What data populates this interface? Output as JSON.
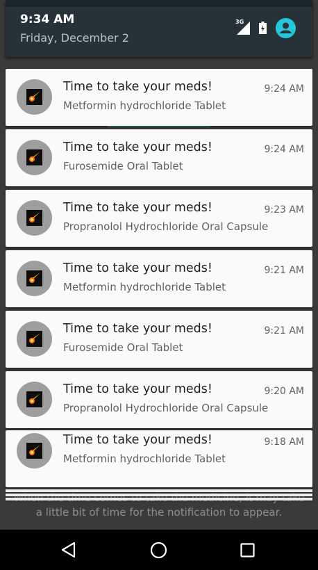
{
  "status": {
    "time": "9:34 AM",
    "date": "Friday, December 2",
    "network": "3G"
  },
  "notifications": [
    {
      "title": "Time to take your meds!",
      "subtitle": "Metformin hydrochloride Tablet",
      "time": "9:24 AM"
    },
    {
      "title": "Time to take your meds!",
      "subtitle": "Furosemide Oral Tablet",
      "time": "9:24 AM"
    },
    {
      "title": "Time to take your meds!",
      "subtitle": "Propranolol Hydrochloride Oral Capsule",
      "time": "9:23 AM"
    },
    {
      "title": "Time to take your meds!",
      "subtitle": "Metformin hydrochloride Tablet",
      "time": "9:21 AM"
    },
    {
      "title": "Time to take your meds!",
      "subtitle": "Furosemide Oral Tablet",
      "time": "9:21 AM"
    },
    {
      "title": "Time to take your meds!",
      "subtitle": "Propranolol Hydrochloride Oral Capsule",
      "time": "9:20 AM"
    },
    {
      "title": "Time to take your meds!",
      "subtitle": "Metformin hydrochloride Tablet",
      "time": "9:18 AM"
    }
  ],
  "background_text": {
    "line1": "When the time comes to take the medicine, it may take",
    "line2": "a little bit of time for the notification to appear."
  },
  "nav": {
    "back": "back-icon",
    "home": "home-icon",
    "recents": "recents-icon"
  },
  "colors": {
    "accent": "#26c6da",
    "shade": "#263238",
    "card": "#fafafa"
  }
}
